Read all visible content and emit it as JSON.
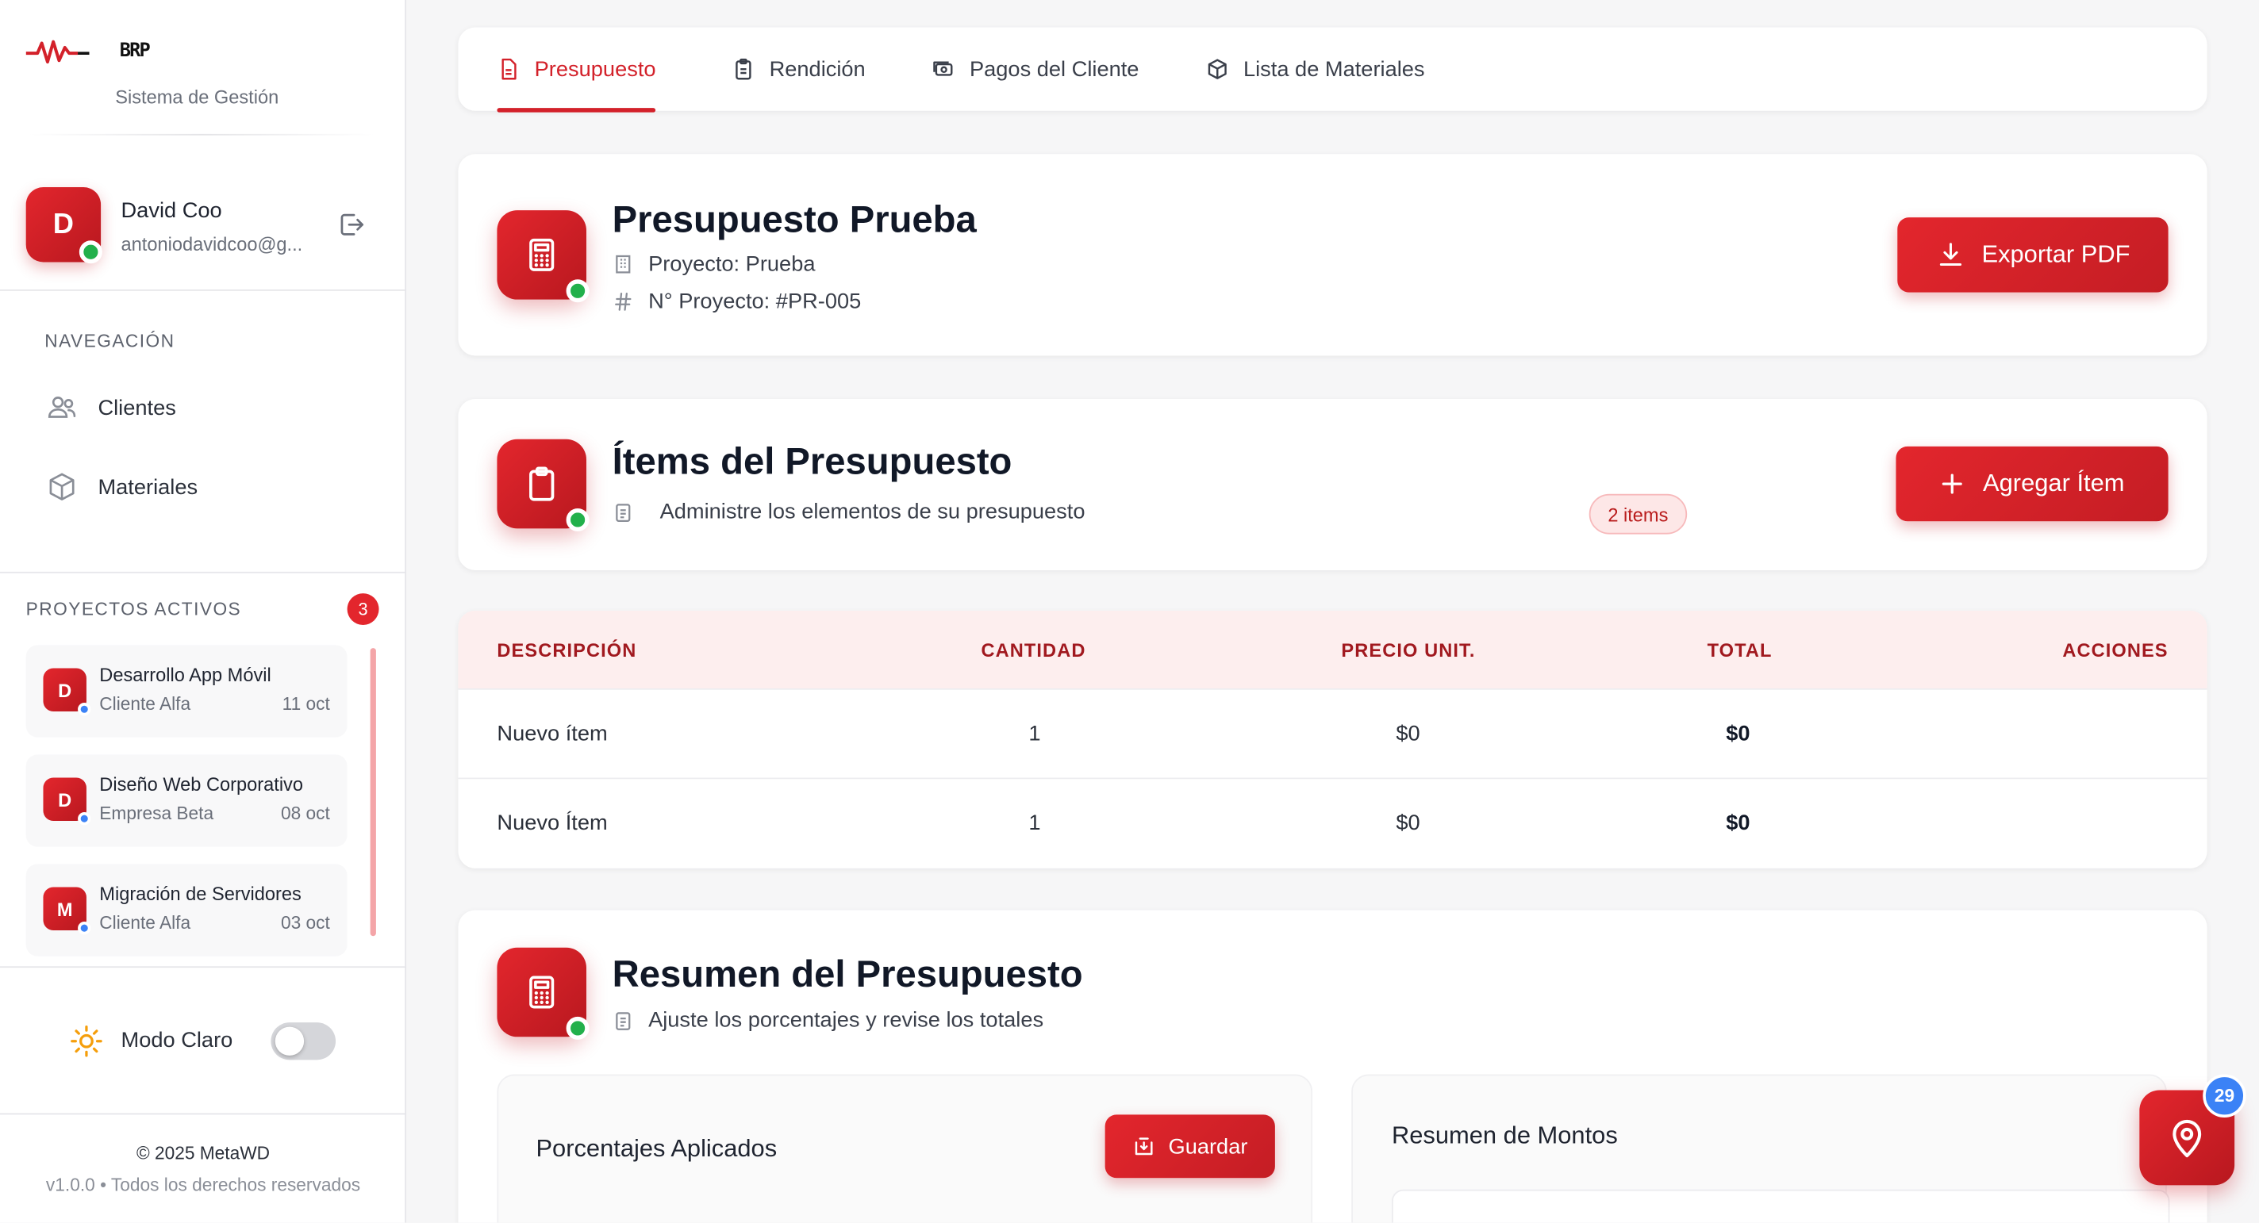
{
  "brand": {
    "logo_text": "BRP",
    "subtitle": "Sistema de Gestión"
  },
  "user": {
    "initial": "D",
    "name": "David Coo",
    "email": "antoniodavidcoo@g..."
  },
  "nav": {
    "title": "NAVEGACIÓN",
    "items": [
      {
        "label": "Clientes",
        "icon": "users-icon"
      },
      {
        "label": "Materiales",
        "icon": "cube-icon"
      }
    ]
  },
  "projects": {
    "title": "PROYECTOS ACTIVOS",
    "count": "3",
    "items": [
      {
        "initial": "D",
        "name": "Desarrollo App Móvil",
        "client": "Cliente Alfa",
        "date": "11 oct"
      },
      {
        "initial": "D",
        "name": "Diseño Web Corporativo",
        "client": "Empresa Beta",
        "date": "08 oct"
      },
      {
        "initial": "M",
        "name": "Migración de Servidores",
        "client": "Cliente Alfa",
        "date": "03 oct"
      }
    ]
  },
  "theme": {
    "label": "Modo Claro",
    "enabled": false
  },
  "footer": {
    "copyright": "© 2025 MetaWD",
    "version": "v1.0.0 • Todos los derechos reservados"
  },
  "tabs": [
    {
      "label": "Presupuesto",
      "icon": "document-icon",
      "active": true
    },
    {
      "label": "Rendición",
      "icon": "clipboard-icon",
      "active": false
    },
    {
      "label": "Pagos del Cliente",
      "icon": "cash-icon",
      "active": false
    },
    {
      "label": "Lista de Materiales",
      "icon": "box-icon",
      "active": false
    }
  ],
  "header": {
    "title": "Presupuesto Prueba",
    "project": "Proyecto: Prueba",
    "project_number": "N° Proyecto: #PR-005",
    "export_label": "Exportar PDF"
  },
  "items_section": {
    "title": "Ítems del Presupuesto",
    "subtitle": "Administre los elementos de su presupuesto",
    "badge": "2 items",
    "add_label": "Agregar Ítem"
  },
  "table": {
    "columns": [
      "DESCRIPCIÓN",
      "CANTIDAD",
      "PRECIO UNIT.",
      "TOTAL",
      "ACCIONES"
    ],
    "rows": [
      {
        "description": "Nuevo ítem",
        "quantity": "1",
        "unit_price": "$0",
        "total": "$0"
      },
      {
        "description": "Nuevo Ítem",
        "quantity": "1",
        "unit_price": "$0",
        "total": "$0"
      }
    ]
  },
  "summary": {
    "title": "Resumen del Presupuesto",
    "subtitle": "Ajuste los porcentajes y revise los totales",
    "percentages_title": "Porcentajes Aplicados",
    "save_label": "Guardar",
    "amounts_title": "Resumen de Montos"
  },
  "fab": {
    "badge": "29",
    "icon": "map-pin-icon"
  },
  "colors": {
    "accent": "#d3212a",
    "accent_dark": "#b8181f",
    "online": "#22b04b",
    "info": "#3b82f6"
  }
}
